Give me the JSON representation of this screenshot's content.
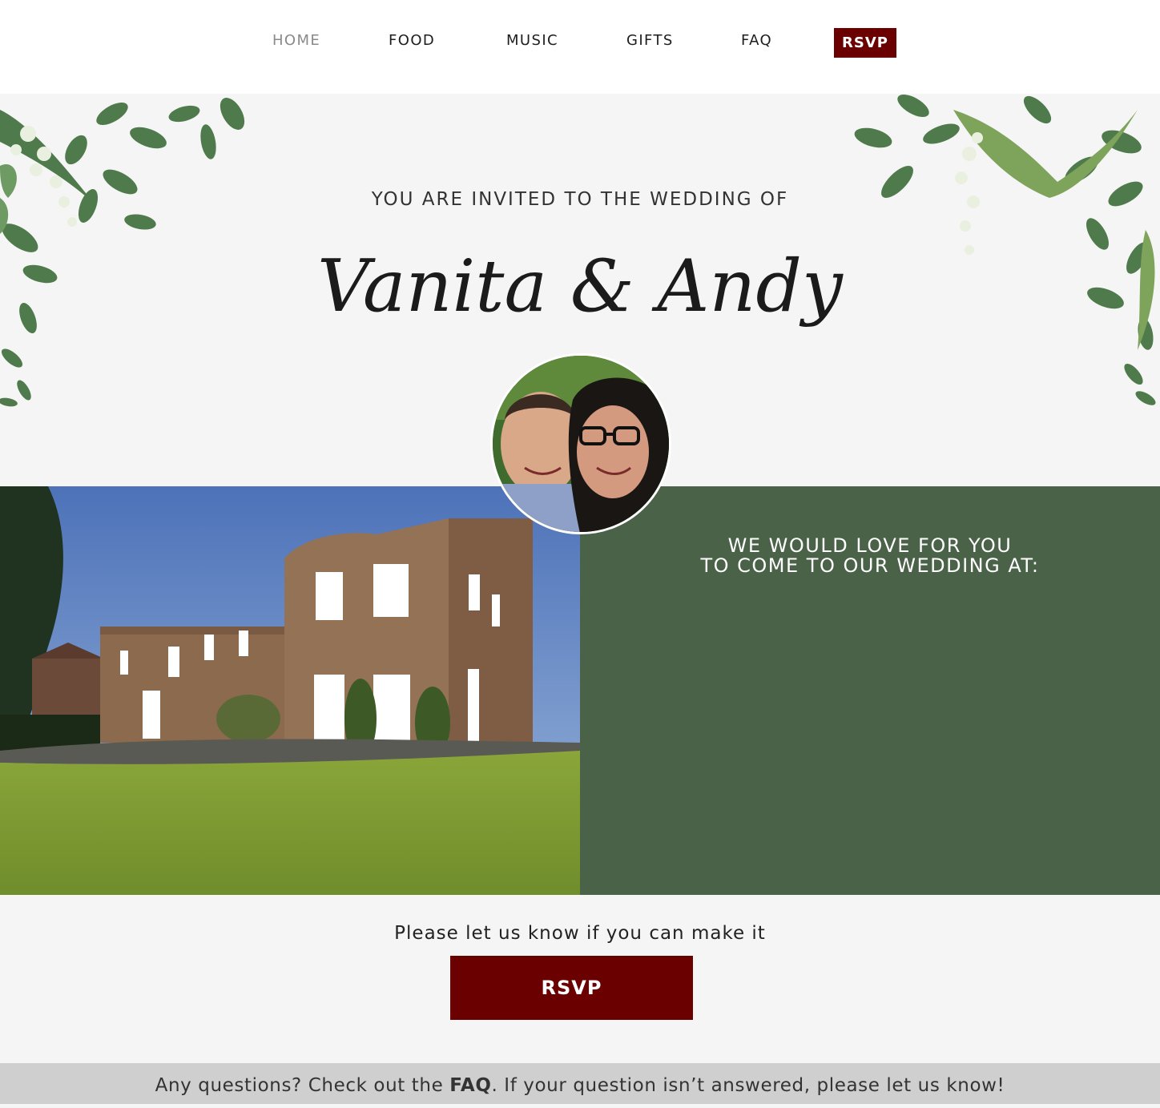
{
  "nav": {
    "items": [
      {
        "label": "HOME",
        "active": true
      },
      {
        "label": "FOOD"
      },
      {
        "label": "MUSIC"
      },
      {
        "label": "GIFTS"
      },
      {
        "label": "FAQ"
      }
    ],
    "rsvp_label": "RSVP"
  },
  "hero": {
    "invite_text": "YOU ARE INVITED TO THE WEDDING OF",
    "names": "Vanita & Andy"
  },
  "venue": {
    "heading_line1": "WE WOULD LOVE FOR YOU",
    "heading_line2": "TO COME TO OUR WEDDING AT:"
  },
  "rsvp": {
    "prompt": "Please let us know if you can make it",
    "button_label": "RSVP"
  },
  "footer": {
    "text_before": "Any questions? Check out the ",
    "faq_link": "FAQ",
    "text_after": ". If your question isn’t answered, please let us know!"
  },
  "colors": {
    "accent_red": "#6b0000",
    "panel_green": "#4a6348",
    "footer_gray": "#cfcfcf"
  }
}
